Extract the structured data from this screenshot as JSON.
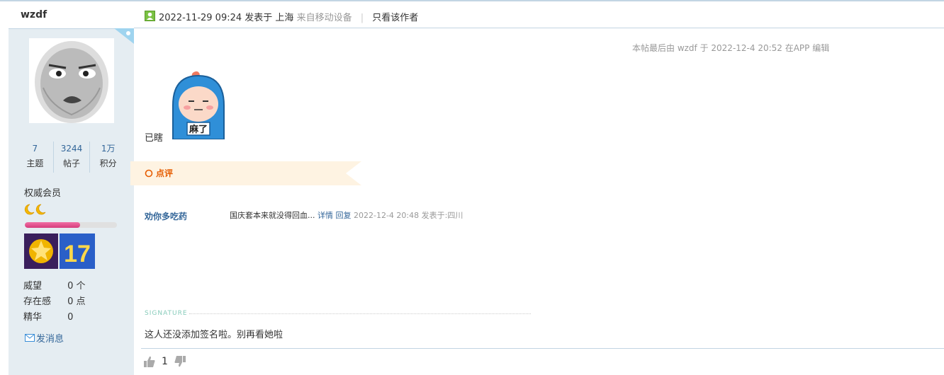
{
  "author": {
    "name": "wzdf",
    "stats": [
      {
        "value": "7",
        "label": "主题"
      },
      {
        "value": "3244",
        "label": "帖子"
      },
      {
        "value": "1万",
        "label": "积分"
      }
    ],
    "group": "权威会员",
    "level_progress": 0.6,
    "info": [
      {
        "key": "威望",
        "value": "0 个"
      },
      {
        "key": "存在感",
        "value": "0 点"
      },
      {
        "key": "精华",
        "value": "0"
      }
    ],
    "message_label": "发消息"
  },
  "post": {
    "date": "2022-11-29 09:24",
    "posted_in": "发表于 上海",
    "device": "来自移动设备",
    "only_author": "只看该作者",
    "edit_note": "本帖最后由 wzdf 于 2022-12-4 20:52 在APP 编辑",
    "content": "已瞎",
    "sticker_text": "麻了"
  },
  "comments": {
    "title": "点评",
    "items": [
      {
        "user": "劝你多吃药",
        "text": "国庆套本来就没得回血...",
        "detail": "详情",
        "reply": "回复",
        "time": "2022-12-4 20:48 发表于:四川"
      }
    ]
  },
  "signature": {
    "label": "SIGNATURE",
    "text": "这人还没添加签名啦。别再看她啦"
  },
  "footer": {
    "likes": "1"
  },
  "colors": {
    "sidebar_bg": "#e5edf2",
    "link": "#336699",
    "accent_orange": "#e65c00",
    "border": "#c2d5e3"
  }
}
